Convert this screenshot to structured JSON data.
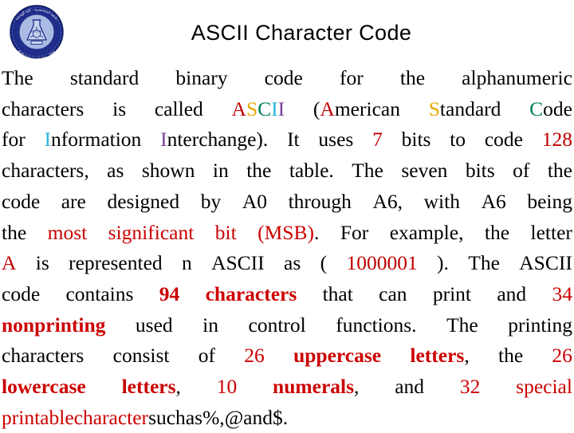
{
  "slide": {
    "title": "ASCII Character Code",
    "logo": {
      "name": "university-seal-logo",
      "ring_color": "#1F2D8A",
      "inner_color": "#9FB4DD",
      "ring_text_top": "جامعة المستنصرية - كلية الهندسة",
      "ring_text_bottom": "Al-Mustansiriyah Univ. - Eng.",
      "inner_text": "BTCD3I01"
    },
    "colors": {
      "red": "#C00000",
      "red_alt": "#CC0000",
      "gold": "#E8A800",
      "green": "#008055",
      "cyan": "#29B6D8",
      "purple": "#7B3F99",
      "black": "#000000"
    },
    "lines": [
      {
        "id": "line-1",
        "justify": true,
        "words": [
          {
            "t": "The",
            "c": "black"
          },
          {
            "t": "standard",
            "c": "black"
          },
          {
            "t": "binary",
            "c": "black"
          },
          {
            "t": "code",
            "c": "black"
          },
          {
            "t": "for",
            "c": "black"
          },
          {
            "t": "the",
            "c": "black"
          },
          {
            "t": "alphanumeric",
            "c": "black"
          }
        ]
      },
      {
        "id": "line-2",
        "justify": true,
        "words": [
          {
            "t": "characters",
            "c": "black"
          },
          {
            "t": "is",
            "c": "black"
          },
          {
            "t": "called",
            "c": "black"
          },
          {
            "t": "ASCII",
            "c": "multi",
            "parts": [
              {
                "t": "A",
                "c": "red"
              },
              {
                "t": "S",
                "c": "gold"
              },
              {
                "t": "C",
                "c": "green"
              },
              {
                "t": "I",
                "c": "cyan"
              },
              {
                "t": "I",
                "c": "purple"
              }
            ]
          },
          {
            "t": "(American",
            "c": "multi",
            "parts": [
              {
                "t": "(",
                "c": "black"
              },
              {
                "t": "A",
                "c": "red"
              },
              {
                "t": "merican",
                "c": "black"
              }
            ]
          },
          {
            "t": "Standard",
            "c": "multi",
            "parts": [
              {
                "t": "S",
                "c": "gold"
              },
              {
                "t": "tandard",
                "c": "black"
              }
            ]
          },
          {
            "t": "Code",
            "c": "multi",
            "parts": [
              {
                "t": "C",
                "c": "green"
              },
              {
                "t": "ode",
                "c": "black"
              }
            ]
          }
        ]
      },
      {
        "id": "line-3",
        "justify": true,
        "words": [
          {
            "t": "for",
            "c": "black"
          },
          {
            "t": "Information",
            "c": "multi",
            "parts": [
              {
                "t": "I",
                "c": "cyan"
              },
              {
                "t": "nformation",
                "c": "black"
              }
            ]
          },
          {
            "t": "Interchange).",
            "c": "multi",
            "parts": [
              {
                "t": "I",
                "c": "purple"
              },
              {
                "t": "nterchange).",
                "c": "black"
              }
            ]
          },
          {
            "t": "It",
            "c": "black"
          },
          {
            "t": "uses",
            "c": "black"
          },
          {
            "t": "7",
            "c": "red"
          },
          {
            "t": "bits",
            "c": "black"
          },
          {
            "t": "to",
            "c": "black"
          },
          {
            "t": "code",
            "c": "black"
          },
          {
            "t": "128",
            "c": "red"
          }
        ]
      },
      {
        "id": "line-4",
        "justify": true,
        "words": [
          {
            "t": "characters,",
            "c": "black"
          },
          {
            "t": "as",
            "c": "black"
          },
          {
            "t": "shown",
            "c": "black"
          },
          {
            "t": "in",
            "c": "black"
          },
          {
            "t": "the",
            "c": "black"
          },
          {
            "t": "table.",
            "c": "black"
          },
          {
            "t": "The",
            "c": "black"
          },
          {
            "t": "seven",
            "c": "black"
          },
          {
            "t": "bits",
            "c": "black"
          },
          {
            "t": "of",
            "c": "black"
          },
          {
            "t": "the",
            "c": "black"
          }
        ]
      },
      {
        "id": "line-5",
        "justify": true,
        "words": [
          {
            "t": "code",
            "c": "black"
          },
          {
            "t": "are",
            "c": "black"
          },
          {
            "t": "designed",
            "c": "black"
          },
          {
            "t": "by",
            "c": "black"
          },
          {
            "t": "A0",
            "c": "black"
          },
          {
            "t": "through",
            "c": "black"
          },
          {
            "t": "A6,",
            "c": "black"
          },
          {
            "t": "with",
            "c": "black"
          },
          {
            "t": "A6",
            "c": "black"
          },
          {
            "t": "being",
            "c": "black"
          }
        ]
      },
      {
        "id": "line-6",
        "justify": true,
        "words": [
          {
            "t": "the",
            "c": "black"
          },
          {
            "t": "most",
            "c": "red_alt"
          },
          {
            "t": "significant",
            "c": "red_alt"
          },
          {
            "t": "bit",
            "c": "red_alt"
          },
          {
            "t": "(MSB).",
            "c": "multi",
            "parts": [
              {
                "t": "(MSB)",
                "c": "red_alt"
              },
              {
                "t": ".",
                "c": "black"
              }
            ]
          },
          {
            "t": "For",
            "c": "black"
          },
          {
            "t": "example,",
            "c": "black"
          },
          {
            "t": "the",
            "c": "black"
          },
          {
            "t": "letter",
            "c": "black"
          }
        ]
      },
      {
        "id": "line-7",
        "justify": true,
        "words": [
          {
            "t": "A",
            "c": "red"
          },
          {
            "t": "is",
            "c": "black"
          },
          {
            "t": "represented",
            "c": "black"
          },
          {
            "t": "n",
            "c": "black"
          },
          {
            "t": "ASCII",
            "c": "black"
          },
          {
            "t": "as",
            "c": "black"
          },
          {
            "t": "(",
            "c": "black"
          },
          {
            "t": "1000001",
            "c": "red"
          },
          {
            "t": ").",
            "c": "black"
          },
          {
            "t": "The",
            "c": "black"
          },
          {
            "t": "ASCII",
            "c": "black"
          }
        ]
      },
      {
        "id": "line-8",
        "justify": true,
        "words": [
          {
            "t": "code",
            "c": "black"
          },
          {
            "t": "contains",
            "c": "black"
          },
          {
            "t": "94",
            "c": "red_alt",
            "b": true
          },
          {
            "t": "characters",
            "c": "red_alt",
            "b": true
          },
          {
            "t": "that",
            "c": "black"
          },
          {
            "t": "can",
            "c": "black"
          },
          {
            "t": "print",
            "c": "black"
          },
          {
            "t": "and",
            "c": "black"
          },
          {
            "t": "34",
            "c": "red_alt"
          }
        ]
      },
      {
        "id": "line-9",
        "justify": true,
        "words": [
          {
            "t": "nonprinting",
            "c": "red_alt",
            "b": true
          },
          {
            "t": "used",
            "c": "black"
          },
          {
            "t": "in",
            "c": "black"
          },
          {
            "t": "control",
            "c": "black"
          },
          {
            "t": "functions.",
            "c": "black"
          },
          {
            "t": "The",
            "c": "black"
          },
          {
            "t": "printing",
            "c": "black"
          }
        ]
      },
      {
        "id": "line-10",
        "justify": true,
        "words": [
          {
            "t": "characters",
            "c": "black"
          },
          {
            "t": "consist",
            "c": "black"
          },
          {
            "t": "of",
            "c": "black"
          },
          {
            "t": "26",
            "c": "red_alt"
          },
          {
            "t": "uppercase",
            "c": "red_alt",
            "b": true
          },
          {
            "t": "letters,",
            "c": "multi",
            "parts": [
              {
                "t": "letters",
                "c": "red_alt",
                "b": true
              },
              {
                "t": ",",
                "c": "black"
              }
            ]
          },
          {
            "t": "the",
            "c": "black"
          },
          {
            "t": "26",
            "c": "red_alt"
          }
        ]
      },
      {
        "id": "line-11",
        "justify": true,
        "words": [
          {
            "t": "lowercase",
            "c": "red_alt",
            "b": true
          },
          {
            "t": "letters,",
            "c": "multi",
            "parts": [
              {
                "t": "letters",
                "c": "red_alt",
                "b": true
              },
              {
                "t": ",",
                "c": "black"
              }
            ]
          },
          {
            "t": "10",
            "c": "red_alt"
          },
          {
            "t": "numerals,",
            "c": "multi",
            "parts": [
              {
                "t": "numerals",
                "c": "red_alt",
                "b": true
              },
              {
                "t": ",",
                "c": "black"
              }
            ]
          },
          {
            "t": "and",
            "c": "black"
          },
          {
            "t": "32",
            "c": "red_alt"
          },
          {
            "t": "special",
            "c": "red_alt"
          }
        ]
      },
      {
        "id": "line-12",
        "justify": false,
        "words": [
          {
            "t": "printable",
            "c": "red_alt"
          },
          {
            "t": "character",
            "c": "red_alt"
          },
          {
            "t": "such",
            "c": "black"
          },
          {
            "t": "as",
            "c": "black"
          },
          {
            "t": "%,",
            "c": "black"
          },
          {
            "t": "@",
            "c": "black"
          },
          {
            "t": "and",
            "c": "black"
          },
          {
            "t": "$.",
            "c": "black"
          }
        ]
      }
    ]
  }
}
